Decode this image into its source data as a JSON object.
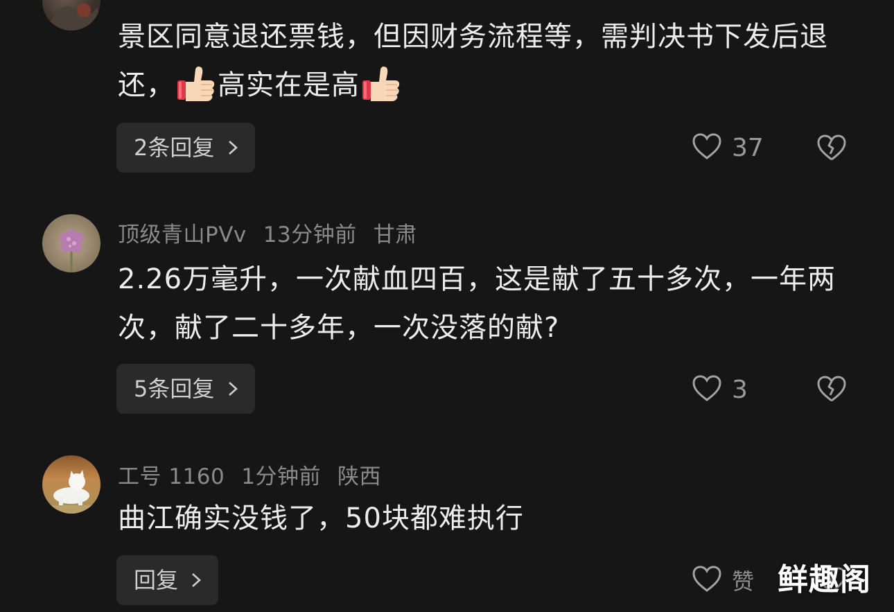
{
  "comments": [
    {
      "meta_cut": "",
      "text_part1": "景区同意退还票钱，但因财务流程等，需判决书下发后退还，",
      "text_part2": "高实在是高",
      "reply_label": "2条回复",
      "like_count": "37",
      "icons": [
        "thumbs-up-emoji",
        "heart-outline-icon",
        "broken-heart-icon",
        "chevron-right-icon"
      ]
    },
    {
      "username": "顶级青山PVv",
      "time": "13分钟前",
      "location": "甘肃",
      "text": "2.26万毫升，一次献血四百，这是献了五十多次，一年两次，献了二十多年，一次没落的献?",
      "reply_label": "5条回复",
      "like_count": "3"
    },
    {
      "username": "工号 1160",
      "time": "1分钟前",
      "location": "陕西",
      "text": "曲江确实没钱了，50块都难执行",
      "reply_label": "回复",
      "like_count": "赞"
    }
  ],
  "watermark": "鲜趣阁",
  "colors": {
    "background": "#161616",
    "button": "#2a2a2a",
    "meta": "#8a8a8a"
  }
}
